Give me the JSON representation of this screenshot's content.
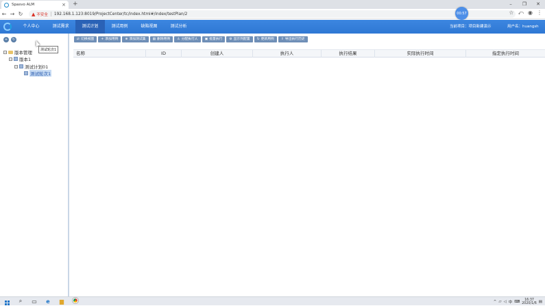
{
  "browser": {
    "tab_title": "Spasvo ALM",
    "tab_close": "×",
    "new_tab": "+",
    "insecure_label": "不安全",
    "url": "192.168.1.123:8019/ProjectCenter/tc/index.html#/index/testPlan/2",
    "timer": "00:57"
  },
  "header": {
    "menu": [
      {
        "label": "个人中心"
      },
      {
        "label": "测试需求"
      },
      {
        "label": "测试计划"
      },
      {
        "label": "测试用例"
      },
      {
        "label": "缺陷视图"
      },
      {
        "label": "测试分析"
      }
    ],
    "project_label": "当前项目：项目新建演示",
    "user_label": "用户名：huangsh"
  },
  "tree": {
    "nodes": [
      {
        "label": "版本管理"
      },
      {
        "label": "版本1"
      },
      {
        "label": "测试计划01"
      },
      {
        "label": "测试轮次1"
      }
    ],
    "tooltip": "测试轮次1"
  },
  "toolbar": {
    "buttons": [
      {
        "label": "切换视图"
      },
      {
        "label": "添加用例"
      },
      {
        "label": "添加测试集"
      },
      {
        "label": "删除用例"
      },
      {
        "label": "分配执行人"
      },
      {
        "label": "批量执行"
      },
      {
        "label": "显示列配置"
      },
      {
        "label": "更新用例"
      },
      {
        "label": "导出执行历史"
      }
    ]
  },
  "grid": {
    "columns": [
      {
        "label": "名称"
      },
      {
        "label": "ID"
      },
      {
        "label": "创建人"
      },
      {
        "label": "执行人"
      },
      {
        "label": "执行结果"
      },
      {
        "label": "实际执行时间"
      },
      {
        "label": "指定执行时间"
      }
    ]
  },
  "taskbar": {
    "tray_lang": "中",
    "time": "16:37",
    "date": "2020/1/6"
  },
  "colors": {
    "header_bg": "#3c86e0",
    "active_menu_bg": "#2a62b6",
    "toolbar_btn": "#6f8fb7"
  }
}
